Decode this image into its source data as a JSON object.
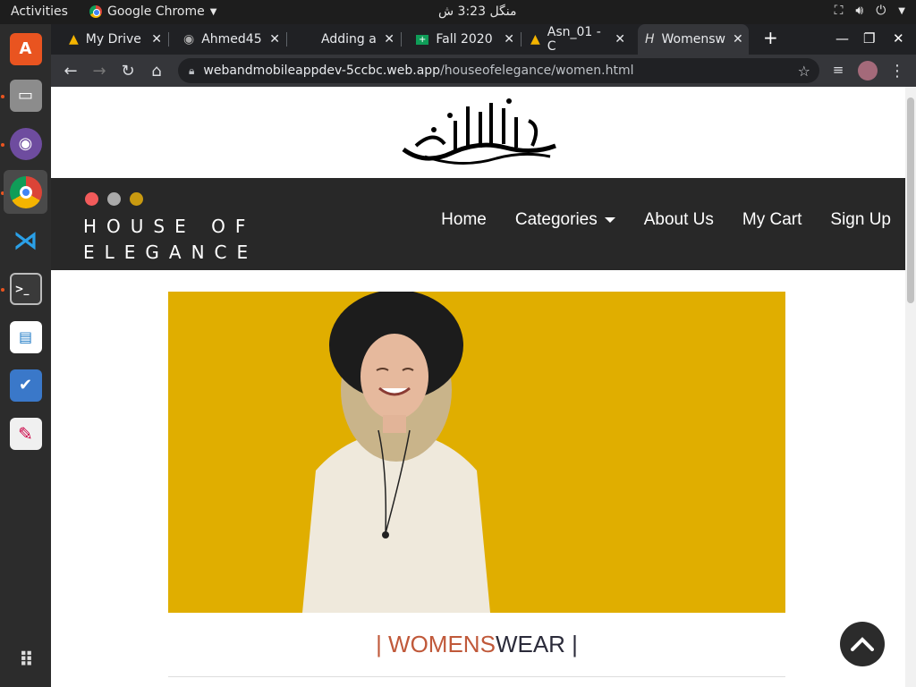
{
  "system": {
    "activities": "Activities",
    "app_name": "Google Chrome",
    "clock": "منگل 3:23 ش"
  },
  "tabs": [
    {
      "label": "My Drive",
      "icon": "google-drive-icon"
    },
    {
      "label": "Ahmed45",
      "icon": "github-icon"
    },
    {
      "label": "Adding a",
      "icon": "blank-icon"
    },
    {
      "label": "Fall 2020",
      "icon": "google-sheets-icon"
    },
    {
      "label": "Asn_01 - C",
      "icon": "google-drive-icon"
    },
    {
      "label": "Womensw",
      "icon": "site-h-icon"
    }
  ],
  "url": {
    "host": "webandmobileappdev-5ccbc.web.app",
    "path": "/houseofelegance/women.html"
  },
  "site": {
    "brand_line1": "HOUSE OF",
    "brand_line2": "ELEGANCE",
    "nav": [
      "Home",
      "Categories",
      "About Us",
      "My Cart",
      "Sign Up"
    ],
    "heading_open": "| ",
    "heading_accent": "WOMENS",
    "heading_rest": "WEAR",
    "heading_close": " |"
  },
  "colors": {
    "dot_red": "#f25b5b",
    "dot_gray": "#aaaaaa",
    "dot_gold": "#c99a10",
    "hero_yellow": "#e2b100",
    "accent": "#c0593a"
  }
}
